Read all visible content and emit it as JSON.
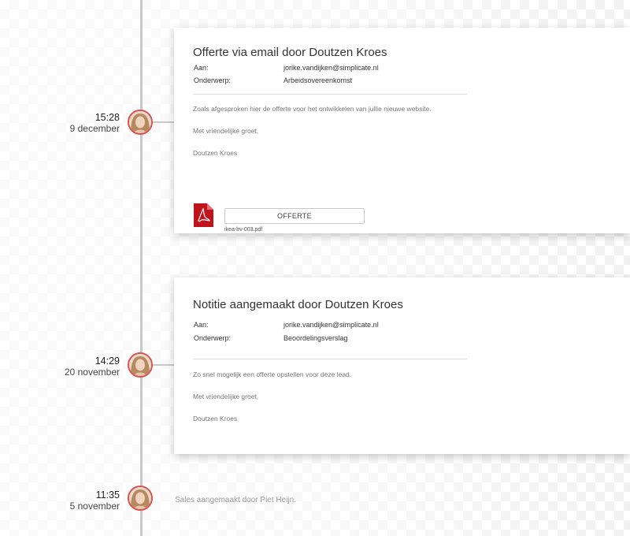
{
  "events": [
    {
      "time": "15:28",
      "date": "9 december",
      "title": "Offerte via email door Doutzen Kroes",
      "to_label": "Aan:",
      "to_value": "jorike.vandijken@simplicate.nl",
      "subject_label": "Onderwerp:",
      "subject_value": "Arbeidsovereenkomst",
      "body": [
        "Zoals afgesproken hier de offerte voor het ontwikkelen van jullie nieuwe website.",
        "Met vriendelijke groet,",
        "Doutzen Kroes"
      ],
      "attachment": {
        "button_label": "OFFERTE",
        "filename": "ikea-bv-003.pdf",
        "icon": "pdf-icon"
      }
    },
    {
      "time": "14:29",
      "date": "20 november",
      "title": "Notitie aangemaakt door Doutzen Kroes",
      "to_label": "Aan:",
      "to_value": "jorike.vandijken@simplicate.nl",
      "subject_label": "Onderwerp:",
      "subject_value": "Beoordelingsverslag",
      "body": [
        "Zo snel mogelijk een offerte opstellen voor deze lead.",
        "Met vriendelijke groet,",
        "Doutzen Kroes"
      ]
    },
    {
      "time": "11:35",
      "date": "5 november",
      "text": "Sales aangemaakt door Piet Heijn."
    }
  ],
  "colors": {
    "avatar_ring": "#d9534f",
    "pdf_red": "#c0141c",
    "timeline": "#c9c9c9"
  }
}
